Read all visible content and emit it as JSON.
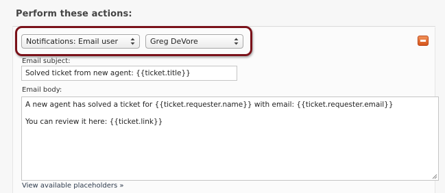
{
  "section": {
    "title": "Perform these actions:"
  },
  "action_row": {
    "action_select": {
      "value": "Notifications: Email user"
    },
    "user_select": {
      "value": "Greg DeVore"
    },
    "remove_icon": "minus-icon"
  },
  "email": {
    "subject_label": "Email subject:",
    "subject_value": "Solved ticket from new agent: {{ticket.title}}",
    "body_label": "Email body:",
    "body_lines": [
      "A new agent has solved a ticket for {{ticket.requester.name}} with email: {{ticket.requester.email}}",
      "You can review it here: {{ticket.link}}"
    ]
  },
  "placeholders_link": "View available placeholders »",
  "colors": {
    "highlight_border": "#7a1119",
    "remove_button": "#e06a2b"
  }
}
